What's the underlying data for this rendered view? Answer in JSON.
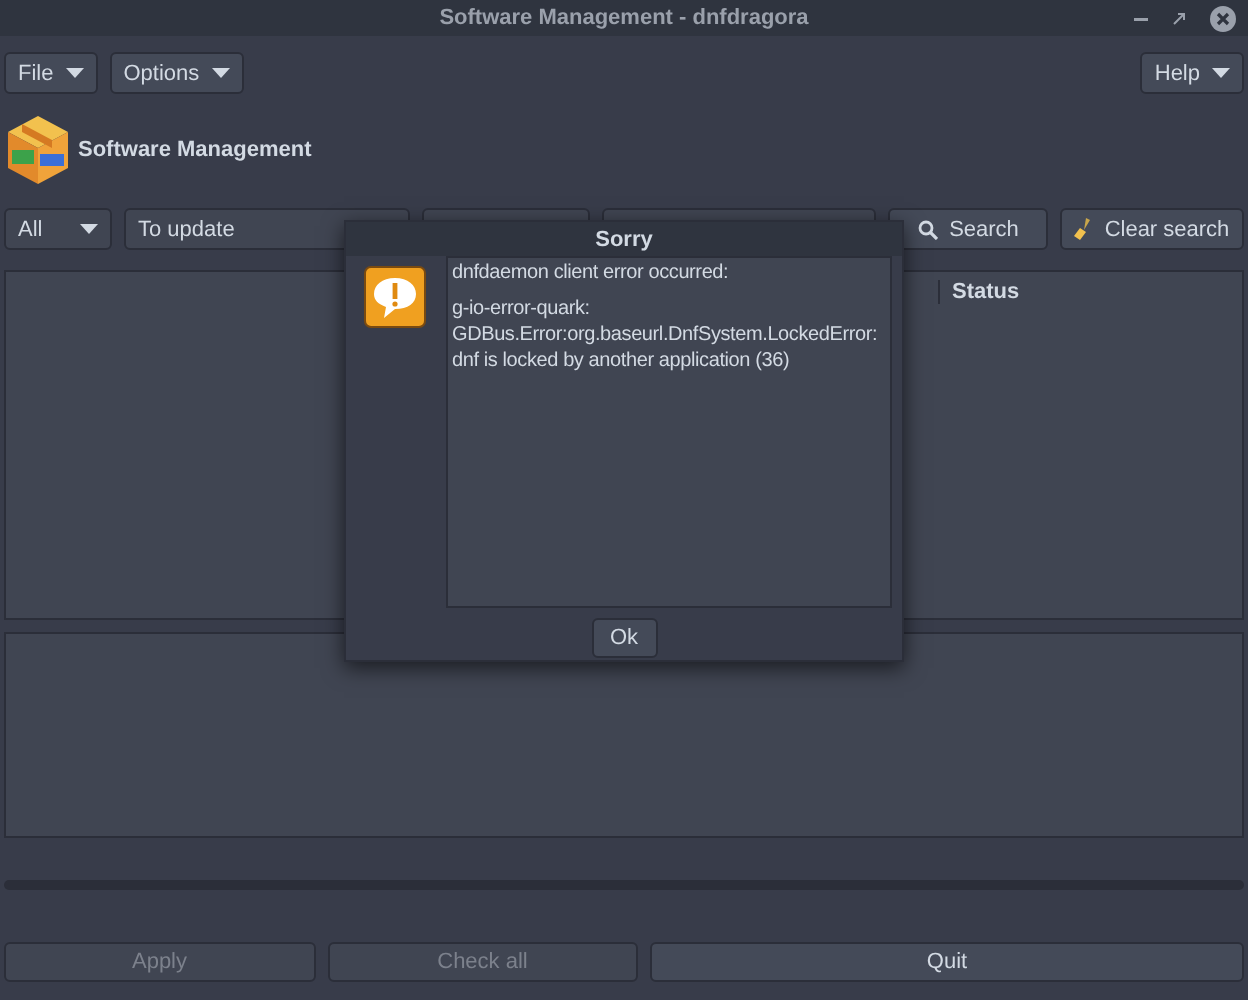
{
  "window": {
    "title": "Software Management - dnfdragora"
  },
  "menus": {
    "left": [
      {
        "label": "File"
      },
      {
        "label": "Options"
      }
    ],
    "right": [
      {
        "label": "Help"
      }
    ]
  },
  "header": {
    "title": "Software Management"
  },
  "filters": {
    "group": "All",
    "view": "To update",
    "search_button": "Search",
    "clear_button": "Clear search"
  },
  "package_list": {
    "columns": [
      "Status"
    ]
  },
  "buttons": [
    {
      "label": "Apply",
      "disabled": true
    },
    {
      "label": "Check all",
      "disabled": true
    },
    {
      "label": "Quit",
      "disabled": false
    }
  ],
  "dialog": {
    "title": "Sorry",
    "message": [
      "dnfdaemon client error occurred:",
      "g-io-error-quark: GDBus.Error:org.baseurl.DnfSystem.LockedError: dnf is locked by another application (36)"
    ],
    "button": "Ok"
  }
}
